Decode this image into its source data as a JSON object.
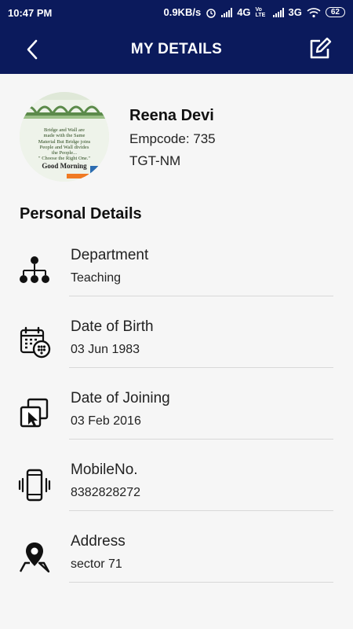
{
  "status_bar": {
    "time": "10:47 PM",
    "speed": "0.9KB/s",
    "network1": "4G",
    "volte": "Vo LTE",
    "network2": "3G",
    "battery": "62"
  },
  "header": {
    "title": "MY DETAILS"
  },
  "profile": {
    "avatar_text": [
      "Bridge and Wall are",
      "made with the Same",
      "Material But Bridge joins",
      "People and Wall divides",
      "the People...",
      "\" Choose the Right One.\"",
      "Good Morning"
    ],
    "name": "Reena Devi",
    "empcode": "Empcode: 735",
    "designation": "TGT-NM"
  },
  "section": {
    "title": "Personal Details"
  },
  "details": [
    {
      "icon": "department-hierarchy-icon",
      "label": "Department",
      "value": "Teaching"
    },
    {
      "icon": "calendar-icon",
      "label": "Date of Birth",
      "value": "03 Jun 1983"
    },
    {
      "icon": "joining-icon",
      "label": "Date of Joining",
      "value": "03 Feb 2016"
    },
    {
      "icon": "mobile-phone-icon",
      "label": "MobileNo.",
      "value": "8382828272"
    },
    {
      "icon": "location-pin-icon",
      "label": "Address",
      "value": "sector 71"
    }
  ]
}
